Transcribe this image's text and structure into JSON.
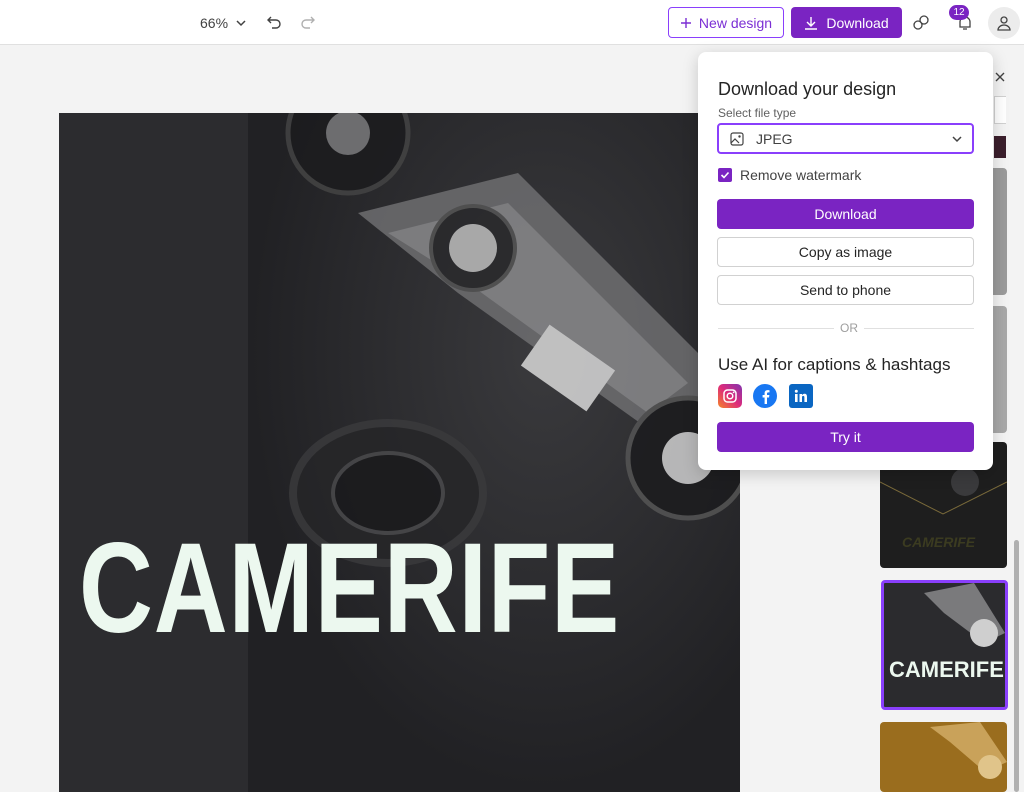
{
  "toolbar": {
    "zoom": "66%",
    "new_design": "New design",
    "download": "Download",
    "notifications_count": "12"
  },
  "canvas": {
    "title_text": "CAMERIFE"
  },
  "thumbnails": [
    {
      "text": "CAMERIFE",
      "color": "#1e1e1e"
    },
    {
      "text": "CAMERIFE",
      "color": "#2b2b2e",
      "selected": true
    },
    {
      "text": "",
      "color": "#9a6d1e"
    }
  ],
  "download_panel": {
    "title": "Download your design",
    "file_type_label": "Select file type",
    "file_type_value": "JPEG",
    "remove_watermark": "Remove watermark",
    "download_button": "Download",
    "copy_button": "Copy as image",
    "phone_button": "Send to phone",
    "or_text": "OR",
    "ai_title": "Use AI for captions & hashtags",
    "try_button": "Try it"
  },
  "colors": {
    "accent": "#7a24c2",
    "accent_border": "#8a3ffc"
  }
}
